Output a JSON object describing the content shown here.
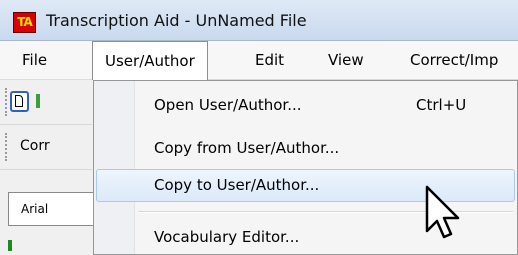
{
  "window": {
    "title": "Transcription Aid - UnNamed File",
    "icon_text": "TA"
  },
  "menubar": {
    "items": [
      {
        "label": "File"
      },
      {
        "label": "User/Author"
      },
      {
        "label": "Edit"
      },
      {
        "label": "View"
      },
      {
        "label": "Correct/Imp"
      }
    ]
  },
  "toolbar": {
    "corr_label": "Corr",
    "font_value": "Arial"
  },
  "dropdown": {
    "items": [
      {
        "label": "Open User/Author...",
        "shortcut": "Ctrl+U"
      },
      {
        "label": "Copy from User/Author..."
      },
      {
        "label": "Copy to User/Author..."
      },
      {
        "label": "Vocabulary Editor..."
      }
    ]
  }
}
